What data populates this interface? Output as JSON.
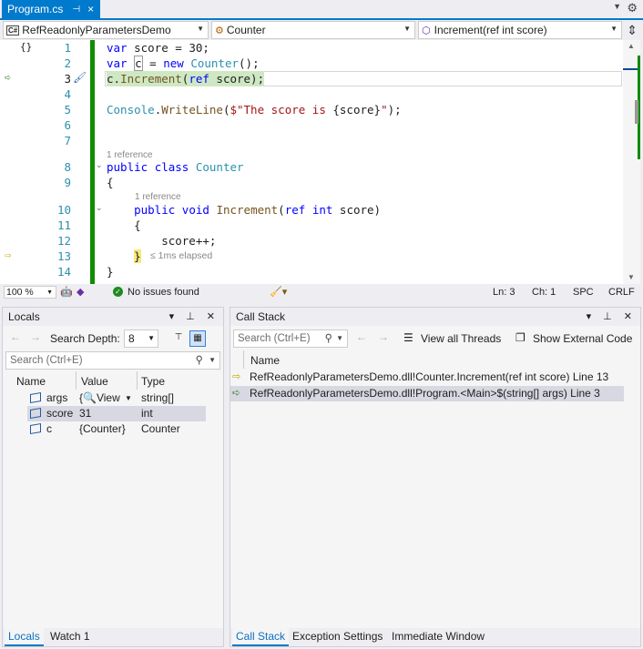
{
  "tab": {
    "title": "Program.cs",
    "pin": "⊣",
    "close": "×"
  },
  "nav": {
    "project": "RefReadonlyParametersDemo",
    "type": "Counter",
    "member": "Increment(ref int score)"
  },
  "editor": {
    "line_numbers": [
      "1",
      "2",
      "3",
      "4",
      "5",
      "6",
      "7",
      "8",
      "9",
      "10",
      "11",
      "12",
      "13",
      "14"
    ],
    "ref_8": "1 reference",
    "ref_10": "1 reference",
    "elapsed": "≤ 1ms elapsed"
  },
  "status": {
    "zoom": "100 %",
    "issues": "No issues found",
    "ln": "Ln: 3",
    "ch": "Ch: 1",
    "spc": "SPC",
    "crlf": "CRLF"
  },
  "locals": {
    "title": "Locals",
    "search_depth_label": "Search Depth:",
    "search_depth_value": "8",
    "search_placeholder": "Search (Ctrl+E)",
    "columns": [
      "Name",
      "Value",
      "Type"
    ],
    "rows": [
      {
        "name": "args",
        "value": "{🔍View",
        "type": "string[]"
      },
      {
        "name": "score",
        "value": "31",
        "type": "int"
      },
      {
        "name": "c",
        "value": "{Counter}",
        "type": "Counter"
      }
    ],
    "tabs": [
      "Locals",
      "Watch 1"
    ]
  },
  "callstack": {
    "title": "Call Stack",
    "search_placeholder": "Search (Ctrl+E)",
    "view_all_threads": "View all Threads",
    "show_external_code": "Show External Code",
    "column": "Name",
    "rows": [
      "RefReadonlyParametersDemo.dll!Counter.Increment(ref int score) Line 13",
      "RefReadonlyParametersDemo.dll!Program.<Main>$(string[] args) Line 3"
    ],
    "tabs": [
      "Call Stack",
      "Exception Settings",
      "Immediate Window"
    ]
  },
  "colors": {
    "accent": "#007acc",
    "keyword": "#0000ff",
    "type": "#2b91af",
    "method": "#74531f",
    "string": "#a31515",
    "changed_green": "#108c00"
  }
}
